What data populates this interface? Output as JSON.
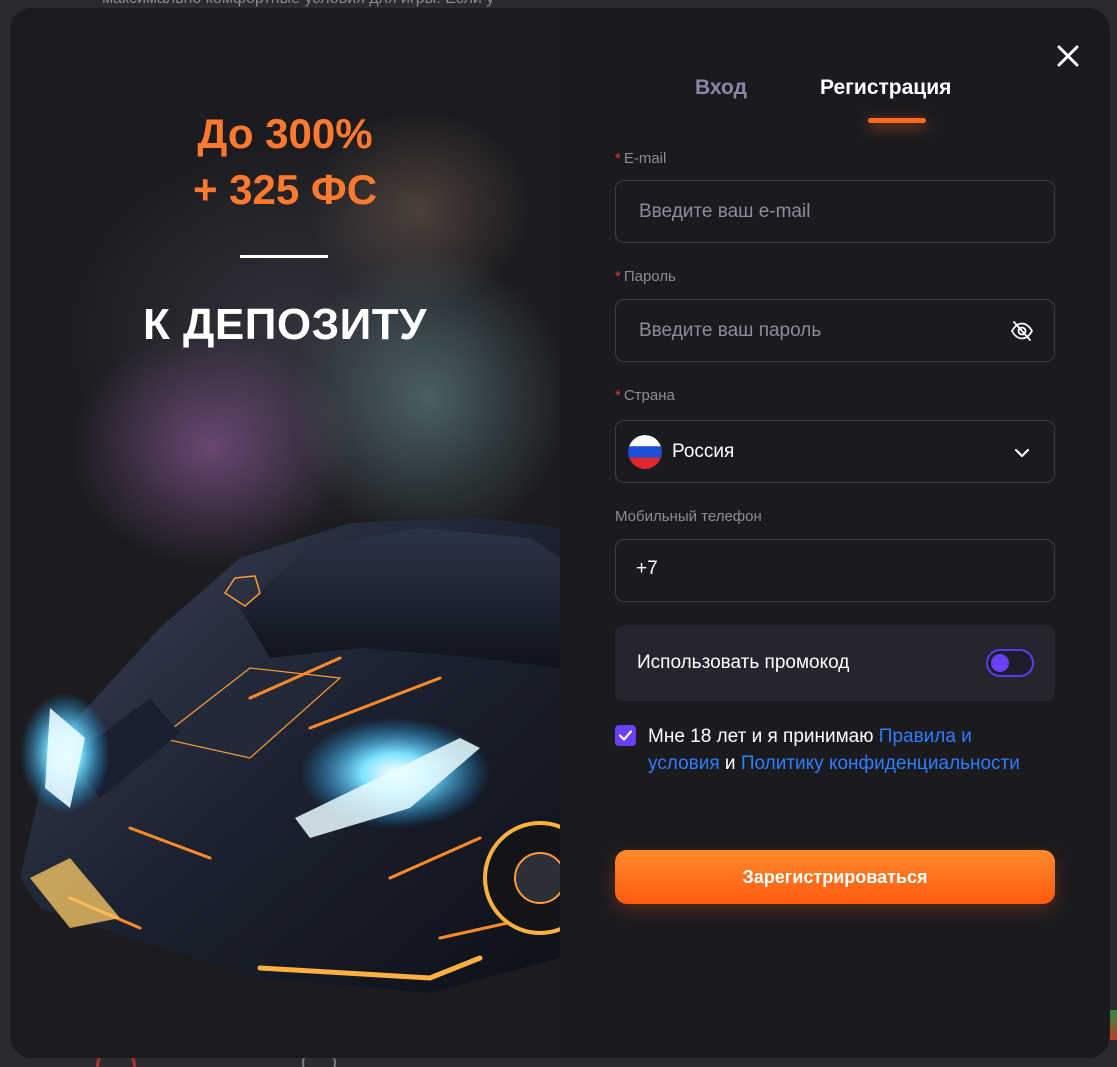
{
  "background_page": {
    "partial_text": "максимально комфортные условия для игры. Если у"
  },
  "promo": {
    "line1": "До 300%",
    "line2": "+ 325 ФС",
    "subtitle": "К ДЕПОЗИТУ"
  },
  "tabs": [
    {
      "label": "Вход",
      "active": false
    },
    {
      "label": "Регистрация",
      "active": true
    }
  ],
  "form": {
    "email": {
      "label": "E-mail",
      "required": true,
      "placeholder": "Введите ваш e-mail",
      "value": ""
    },
    "password": {
      "label": "Пароль",
      "required": true,
      "placeholder": "Введите ваш пароль",
      "value": ""
    },
    "country": {
      "label": "Страна",
      "required": true,
      "value": "Россия",
      "flag": "russia-flag"
    },
    "phone": {
      "label": "Мобильный телефон",
      "required": false,
      "prefix": "+7",
      "value": ""
    },
    "promo_code": {
      "label": "Использовать промокод",
      "enabled": false
    },
    "terms": {
      "checked": true,
      "text_before": "Мне 18 лет и я принимаю ",
      "rules_link": "Правила и условия",
      "text_middle": " и ",
      "privacy_link": "Политику конфиденциальности"
    },
    "submit_label": "Зарегистрироваться"
  },
  "colors": {
    "accent_orange": "#ff6a1e",
    "accent_purple": "#6a3ff5",
    "link_blue": "#2f7dff",
    "modal_bg": "#1b1b1f"
  }
}
